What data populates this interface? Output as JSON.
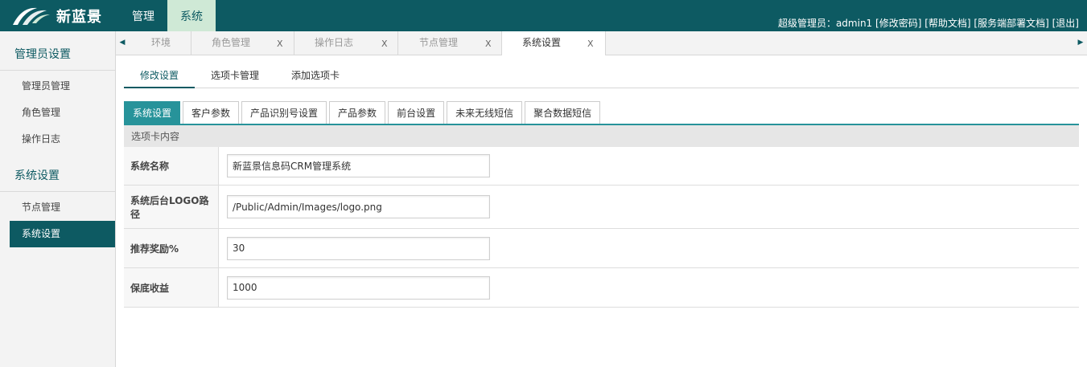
{
  "header": {
    "logo_text": "新蓝景",
    "nav": [
      {
        "label": "管理",
        "active": false
      },
      {
        "label": "系统",
        "active": true
      }
    ],
    "user_role_label": "超级管理员：",
    "username": "admin1",
    "links": [
      "[修改密码]",
      "[帮助文档]",
      "[服务端部署文档]",
      "[退出]"
    ]
  },
  "sidebar": {
    "groups": [
      {
        "title": "管理员设置",
        "items": [
          "管理员管理",
          "角色管理",
          "操作日志"
        ]
      },
      {
        "title": "系统设置",
        "items": [
          "节点管理",
          "系统设置"
        ]
      }
    ],
    "active_item": "系统设置"
  },
  "tabstrip": {
    "left_arrow": "◀",
    "right_arrow": "▶",
    "tabs": [
      {
        "label": "环境",
        "close": ""
      },
      {
        "label": "角色管理",
        "close": "X"
      },
      {
        "label": "操作日志",
        "close": "X"
      },
      {
        "label": "节点管理",
        "close": "X"
      },
      {
        "label": "系统设置",
        "close": "X"
      }
    ],
    "active_index": 4
  },
  "subtabs": {
    "items": [
      "修改设置",
      "选项卡管理",
      "添加选项卡"
    ],
    "active_index": 0
  },
  "config_tabs": {
    "items": [
      "系统设置",
      "客户参数",
      "产品识别号设置",
      "产品参数",
      "前台设置",
      "未来无线短信",
      "聚合数据短信"
    ],
    "active_index": 0
  },
  "form": {
    "section_title": "选项卡内容",
    "rows": [
      {
        "label": "系统名称",
        "value": "新蓝景信息码CRM管理系统"
      },
      {
        "label": "系统后台LOGO路径",
        "value": "/Public/Admin/Images/logo.png"
      },
      {
        "label": "推荐奖励%",
        "value": "30"
      },
      {
        "label": "保底收益",
        "value": "1000"
      }
    ]
  },
  "colors": {
    "brand": "#0d5a62",
    "accent": "#27939a",
    "nav_active_bg": "#cfe9d6"
  }
}
